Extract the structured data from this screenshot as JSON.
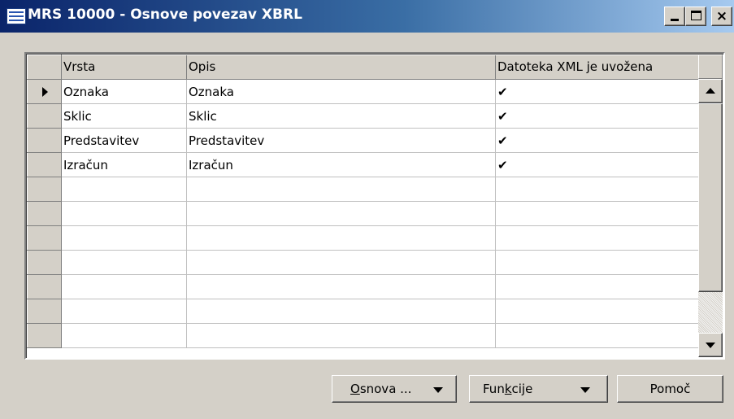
{
  "window": {
    "title": "MRS 10000 - Osnove povezav XBRL",
    "close_glyph": "×"
  },
  "table": {
    "headers": [
      "Vrsta",
      "Opis",
      "Datoteka XML je uvožena"
    ],
    "rows": [
      {
        "vrsta": "Oznaka",
        "opis": "Oznaka",
        "imported": "✔"
      },
      {
        "vrsta": "Sklic",
        "opis": "Sklic",
        "imported": "✔"
      },
      {
        "vrsta": "Predstavitev",
        "opis": "Predstavitev",
        "imported": "✔"
      },
      {
        "vrsta": "Izračun",
        "opis": "Izračun",
        "imported": "✔"
      }
    ],
    "empty_row_count": 7
  },
  "buttons": {
    "osnova": {
      "accel": "O",
      "rest": "snova ..."
    },
    "funkcije": {
      "pre": "Fun",
      "accel": "k",
      "post": "cije"
    },
    "pomoc": "Pomoč"
  },
  "icons": {
    "app": "table-icon",
    "current_row": "row-pointer-icon",
    "scroll_up": "scroll-up-arrow-icon",
    "scroll_down": "scroll-down-arrow-icon",
    "dropdown": "dropdown-arrow-icon"
  },
  "colors": {
    "titlebar_start": "#0a246a",
    "titlebar_end": "#a6caf0",
    "face": "#d4d0c8"
  }
}
